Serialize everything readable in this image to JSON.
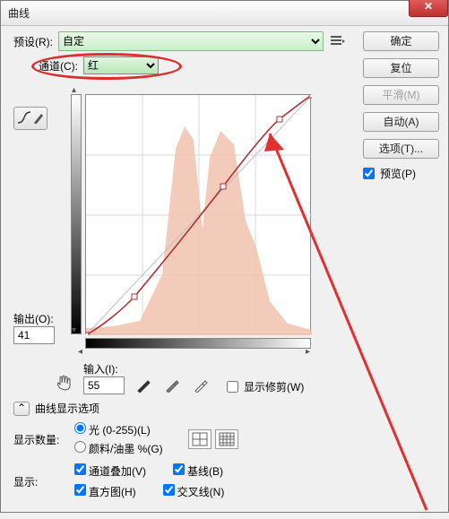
{
  "title": "曲线",
  "preset_label": "预设(R):",
  "preset_value": "自定",
  "channel_label": "通道(C):",
  "channel_value": "红",
  "buttons": {
    "ok": "确定",
    "reset": "复位",
    "smooth": "平滑(M)",
    "auto": "自动(A)",
    "options": "选项(T)..."
  },
  "preview_label": "预览(P)",
  "preview_checked": true,
  "output_label": "输出(O):",
  "output_value": "41",
  "input_label": "输入(I):",
  "input_value": "55",
  "show_clip_label": "显示修剪(W)",
  "show_clip_checked": false,
  "acc_title": "曲线显示选项",
  "amount_label": "显示数量:",
  "radio_light": "光 (0-255)(L)",
  "radio_pigment": "颜料/油墨 %(G)",
  "radio_selected": "light",
  "show_label": "显示:",
  "chk_overlay": "通道叠加(V)",
  "chk_baseline": "基线(B)",
  "chk_histogram": "直方图(H)",
  "chk_intersect": "交叉线(N)",
  "chk_overlay_v": true,
  "chk_baseline_v": true,
  "chk_histogram_v": true,
  "chk_intersect_v": true,
  "chart_data": {
    "type": "line",
    "title": "曲线",
    "xlabel": "输入",
    "ylabel": "输出",
    "xlim": [
      0,
      255
    ],
    "ylim": [
      0,
      255
    ],
    "series": [
      {
        "name": "红",
        "points": [
          {
            "x": 0,
            "y": 0
          },
          {
            "x": 55,
            "y": 41
          },
          {
            "x": 155,
            "y": 158
          },
          {
            "x": 219,
            "y": 229
          },
          {
            "x": 255,
            "y": 255
          }
        ]
      }
    ],
    "histogram_channel": "红"
  }
}
